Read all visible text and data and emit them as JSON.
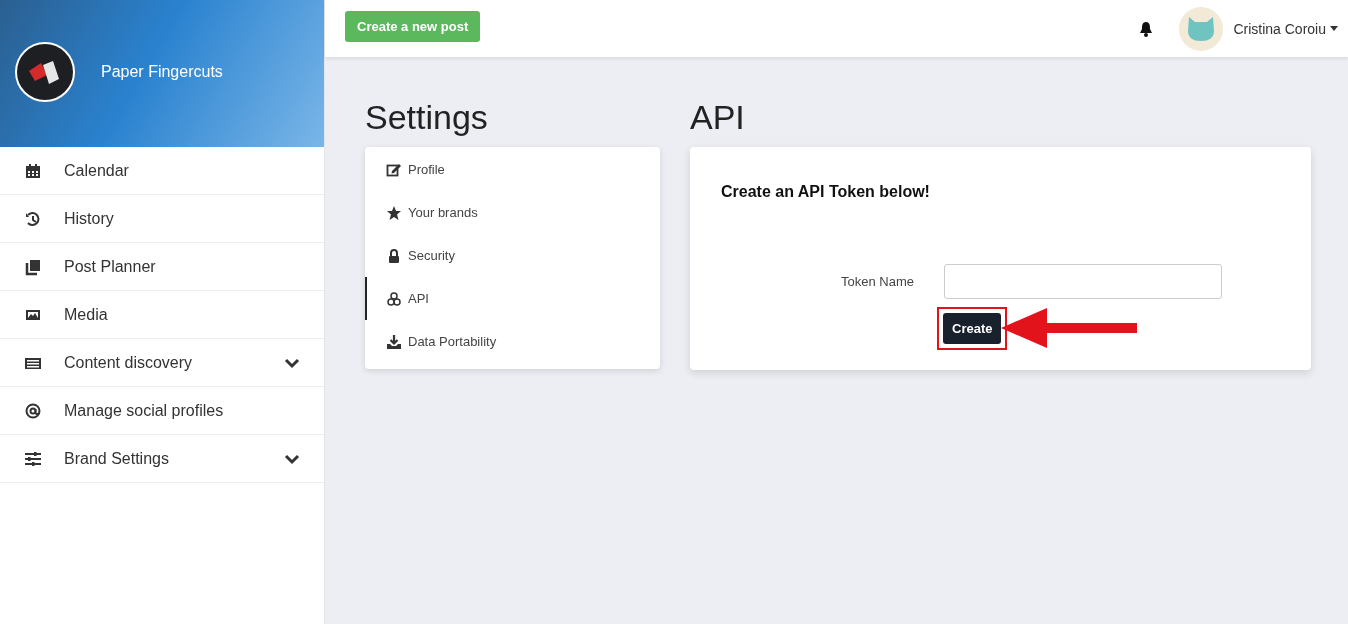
{
  "sidebar": {
    "brand_name": "Paper Fingercuts",
    "items": [
      {
        "label": "Calendar",
        "expandable": false
      },
      {
        "label": "History",
        "expandable": false
      },
      {
        "label": "Post Planner",
        "expandable": false
      },
      {
        "label": "Media",
        "expandable": false
      },
      {
        "label": "Content discovery",
        "expandable": true
      },
      {
        "label": "Manage social profiles",
        "expandable": false
      },
      {
        "label": "Brand Settings",
        "expandable": true
      }
    ]
  },
  "topbar": {
    "create_button": "Create a new post",
    "user_name": "Cristina Coroiu"
  },
  "settings": {
    "title": "Settings",
    "menu": [
      {
        "label": "Profile",
        "selected": false
      },
      {
        "label": "Your brands",
        "selected": false
      },
      {
        "label": "Security",
        "selected": false
      },
      {
        "label": "API",
        "selected": true
      },
      {
        "label": "Data Portability",
        "selected": false
      }
    ]
  },
  "api": {
    "title": "API",
    "card_heading": "Create an API Token below!",
    "token_label": "Token Name",
    "create_button": "Create"
  }
}
